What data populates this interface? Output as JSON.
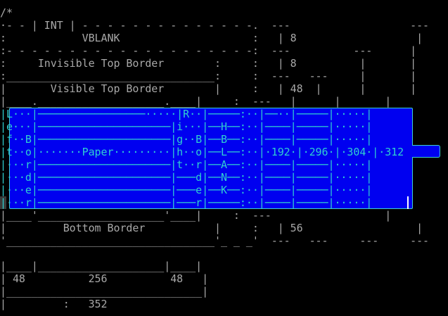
{
  "lines": [
    "/*",
    "·- - | INT | - - - - - - - - - - - - - -.  ---                   ---",
    ":            VBLANK                     :   | 8                   |",
    ":- - - - - - - - - - - - - - - - - - - -:  ---          ---      |",
    ":     Invisible Top Border        :     :   | 8          |       |",
    ":_________________________________:     :  ---   ---     |       |",
    "|       Visible Top Border        |     :   | 48  |      |       |",
    "|____.____________________.____|     :  ---   |      |       |",
    "|L···|─────────────────·····|R··|─────:··|──··|─────|·····|",
    "|e···|─────────────────────|i···|──H──:··|────|─────|·····|",
    "|f··B|─────────────────────|g··B|──B──:··|────|─────|·····|",
    "|t··o|·······Paper·········|h··o|──L──:··|·192·|·296·|·304·|·312",
    "|···r|─────────────────────|t··r|──A──:··|────|─────|·····|",
    "|···d|─────────────────────|───d|──N──:··|────|─────|·····|",
    "|···e|─────────────────────|───e|──K──:··|────|─────|·····|",
    "|···r|─────────────────────|───r|─────:··|────|─────|·····|",
    "|____'____________________'____|     :  ---                  |",
    "|         Bottom Border           |     :   | 56                  |",
    "'_________________________________'_ _ _'  ---   ---     ---     ---",
    "",
    "|____|____________________|____|",
    "| 48          256          48   |",
    "|_______________________________|",
    "|         :   352",
    ""
  ],
  "editor": {
    "background": "#000000",
    "selection_color": "#0000f0",
    "text_color": "#a8a8a8",
    "selected_text_color": "#2fd0d0",
    "highlight_color": "#e6e672"
  }
}
